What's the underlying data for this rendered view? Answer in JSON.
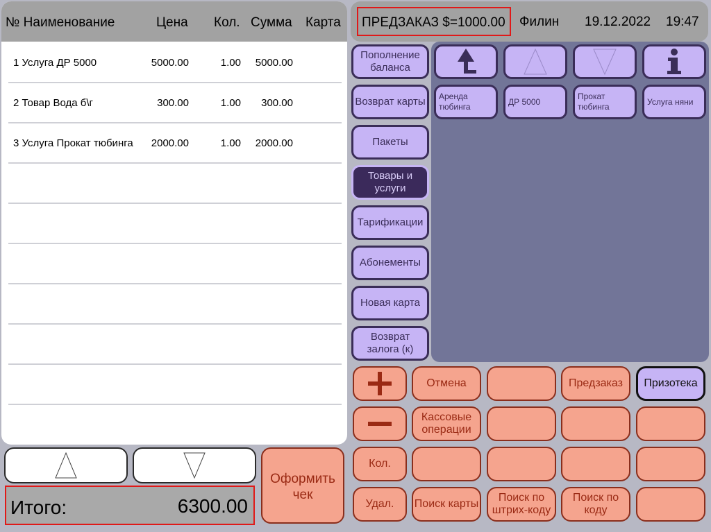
{
  "table": {
    "headers": [
      "№ Наименование",
      "Цена",
      "Кол.",
      "Сумма",
      "Карта"
    ],
    "rows": [
      {
        "name": "1  Услуга ДР 5000",
        "price": "5000.00",
        "qty": "1.00",
        "sum": "5000.00"
      },
      {
        "name": "2  Товар Вода б\\г",
        "price": "300.00",
        "qty": "1.00",
        "sum": "300.00"
      },
      {
        "name": "3  Услуга Прокат тюбинга",
        "price": "2000.00",
        "qty": "1.00",
        "sum": "2000.00"
      }
    ]
  },
  "total": {
    "label": "Итого:",
    "value": "6300.00"
  },
  "checkout_label": "Оформить чек",
  "topbar": {
    "preorder": "ПРЕДЗАКАЗ $=1000.00",
    "user": "Филин",
    "date": "19.12.2022",
    "time": "19:47"
  },
  "menu": [
    "Пополнение баланса",
    "Возврат карты",
    "Пакеты",
    "Товары и услуги",
    "Тарификации",
    "Абонементы",
    "Новая карта",
    "Возврат залога (к)"
  ],
  "catalog": {
    "tiles": [
      "Аренда тюбинга",
      "ДР 5000",
      "Прокат тюбинга",
      "Услуга няни"
    ]
  },
  "ops": {
    "cancel": "Отмена",
    "preorder": "Предзаказ",
    "prize": "Призотека",
    "cash_ops": "Кассовые операции",
    "qty": "Кол.",
    "delete": "Удал.",
    "search_card": "Поиск карты",
    "search_barcode": "Поиск по штрих-коду",
    "search_code": "Поиск по коду"
  },
  "colors": {
    "accent_purple": "#c6b4f5",
    "active_purple": "#3b2a5b",
    "salmon": "#f5a48e",
    "highlight_red": "#e01919",
    "catalog_bg": "#727598"
  }
}
